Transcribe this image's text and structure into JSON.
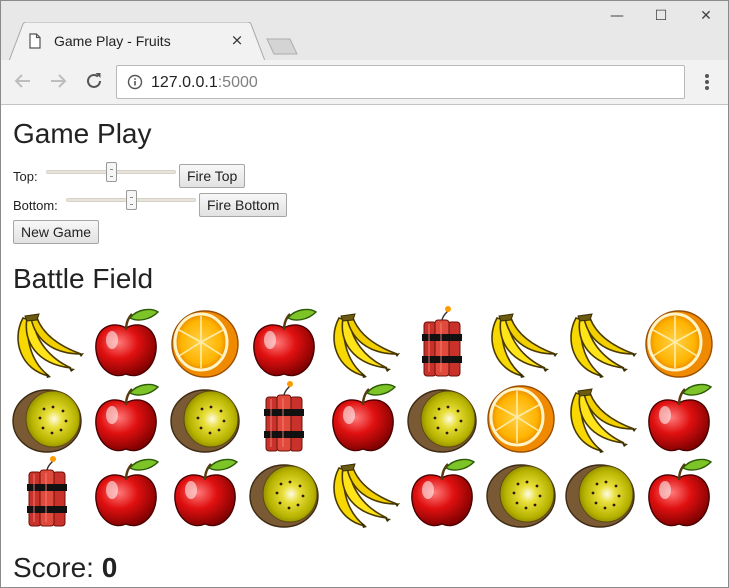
{
  "browser": {
    "tab_title": "Game Play - Fruits",
    "tab_close": "×",
    "url_host": "127.0.0.1",
    "url_port": ":5000",
    "window_controls": {
      "minimize": "—",
      "maximize": "☐",
      "close": "✕"
    }
  },
  "page": {
    "heading": "Game Play",
    "top_label": "Top:",
    "top_slider_level": 0.5,
    "fire_top_label": "Fire Top",
    "bottom_label": "Bottom:",
    "bottom_slider_level": 0.5,
    "fire_bottom_label": "Fire Bottom",
    "new_game_label": "New Game",
    "battlefield_heading": "Battle Field",
    "score_label": "Score:",
    "score_value": "0"
  },
  "battlefield": {
    "rows": [
      [
        "banana",
        "apple",
        "orange",
        "apple",
        "banana",
        "dynamite",
        "banana",
        "banana",
        "orange"
      ],
      [
        "kiwi",
        "apple",
        "kiwi",
        "dynamite",
        "apple",
        "kiwi",
        "orange",
        "banana",
        "apple"
      ],
      [
        "dynamite",
        "apple",
        "apple",
        "kiwi",
        "banana",
        "apple",
        "kiwi",
        "kiwi",
        "apple"
      ]
    ]
  }
}
